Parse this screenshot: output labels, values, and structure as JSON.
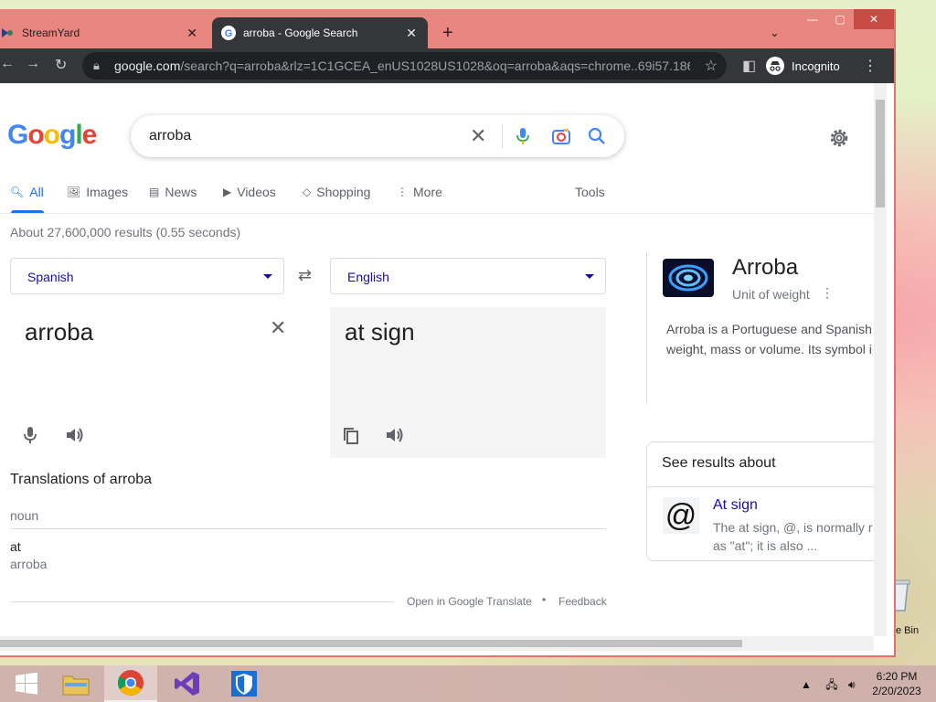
{
  "browser": {
    "tabs": [
      {
        "title": "StreamYard"
      },
      {
        "title": "arroba - Google Search"
      }
    ],
    "url_host": "google.com",
    "url_path": "/search?q=arroba&rlz=1C1GCEA_enUS1028US1028&oq=arroba&aqs=chrome..69i57.186...",
    "profile_label": "Incognito"
  },
  "search": {
    "logo": "Google",
    "query": "arroba",
    "nav_tabs": [
      "All",
      "Images",
      "News",
      "Videos",
      "Shopping",
      "More"
    ],
    "tools_label": "Tools",
    "stats": "About 27,600,000 results (0.55 seconds)"
  },
  "translate": {
    "source_lang": "Spanish",
    "target_lang": "English",
    "source_text": "arroba",
    "target_text": "at sign",
    "translations_title": "Translations of arroba",
    "part_of_speech": "noun",
    "word": "at",
    "word_source": "arroba",
    "open_link": "Open in Google Translate",
    "separator": "•",
    "feedback": "Feedback"
  },
  "knowledge_panel": {
    "title": "Arroba",
    "subtitle": "Unit of weight",
    "description_line1": "Arroba is a Portuguese and Spanish",
    "description_line2": "weight, mass or volume. Its symbol i"
  },
  "see_results": {
    "title": "See results about",
    "item_icon": "@",
    "item_title": "At sign",
    "item_desc_line1": "The at sign, @, is normally r",
    "item_desc_line2": "as \"at\"; it is also ..."
  },
  "desktop": {
    "recycle_label": "e Bin"
  },
  "taskbar": {
    "time": "6:20 PM",
    "date": "2/20/2023"
  }
}
